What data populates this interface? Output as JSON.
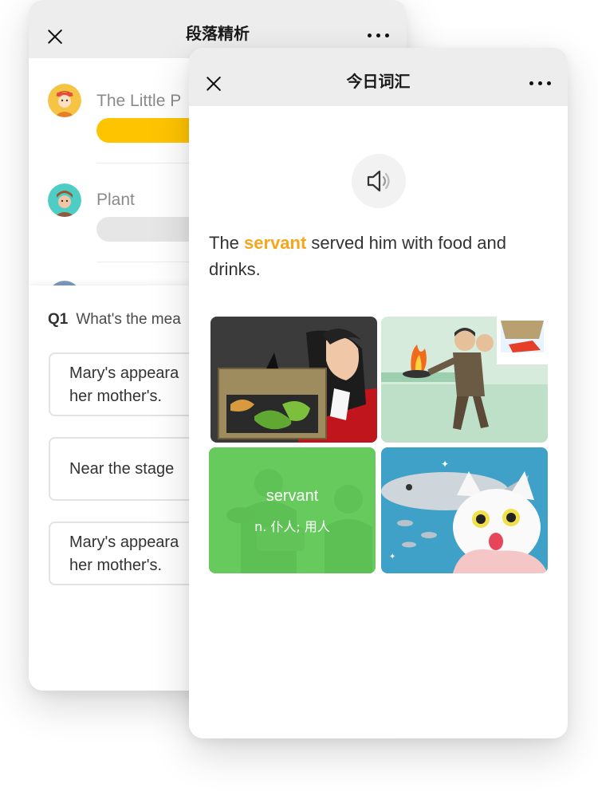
{
  "back_panel": {
    "title": "段落精析",
    "items": [
      {
        "label": "The Little P",
        "progress": 1.0,
        "progress_color": "#ffc400"
      },
      {
        "label": "Plant",
        "progress": 0.0,
        "progress_color": "#e6e6e6"
      }
    ],
    "question": {
      "number": "Q1",
      "text": "What's the mea",
      "options": [
        "Mary's appeara\nher mother's.",
        "Near the stage",
        "Mary's appeara\nher mother's."
      ]
    }
  },
  "front_panel": {
    "title": "今日词汇",
    "sentence": {
      "before": "The ",
      "highlight": "servant",
      "after": " served him with food and drinks."
    },
    "highlight_color": "#f7a51b",
    "tiles": [
      {
        "scene": "man-hiding-snakes-box"
      },
      {
        "scene": "kitchen-fire"
      },
      {
        "scene": "servants-serving",
        "word": "servant",
        "definition": "n. 仆人; 用人",
        "selected": true
      },
      {
        "scene": "cat-and-fish"
      }
    ]
  },
  "icons": [
    "close-icon",
    "more-icon",
    "speaker-icon"
  ]
}
